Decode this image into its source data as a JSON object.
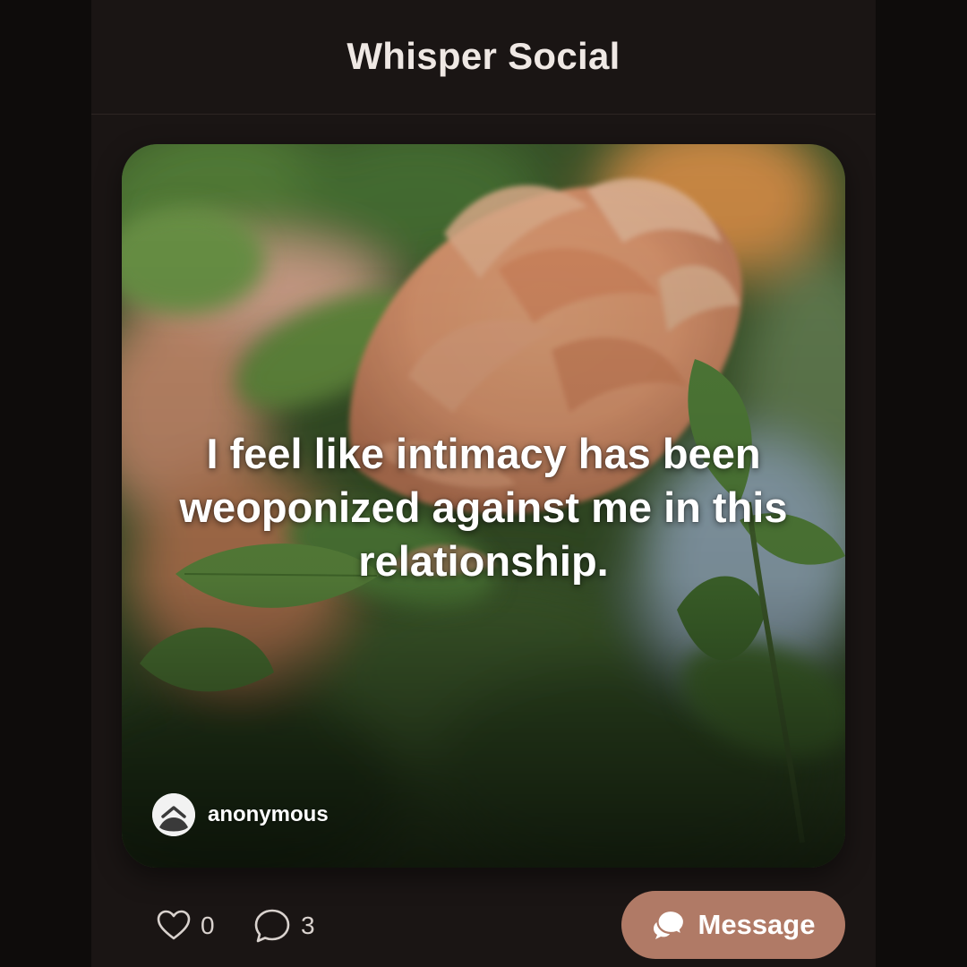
{
  "app": {
    "title": "Whisper Social"
  },
  "post": {
    "text": "I feel like intimacy has been weoponized against me in this relationship.",
    "author": "anonymous",
    "background": "peach-rose-photo"
  },
  "actions": {
    "likes": "0",
    "comments": "3",
    "message_label": "Message"
  },
  "colors": {
    "background": "#1a1514",
    "accent": "#b07a66",
    "title": "#efe8e4"
  },
  "icons": {
    "like": "heart-icon",
    "comment": "speech-bubble-icon",
    "message": "chat-bubbles-icon",
    "avatar": "anonymous-avatar-icon"
  }
}
